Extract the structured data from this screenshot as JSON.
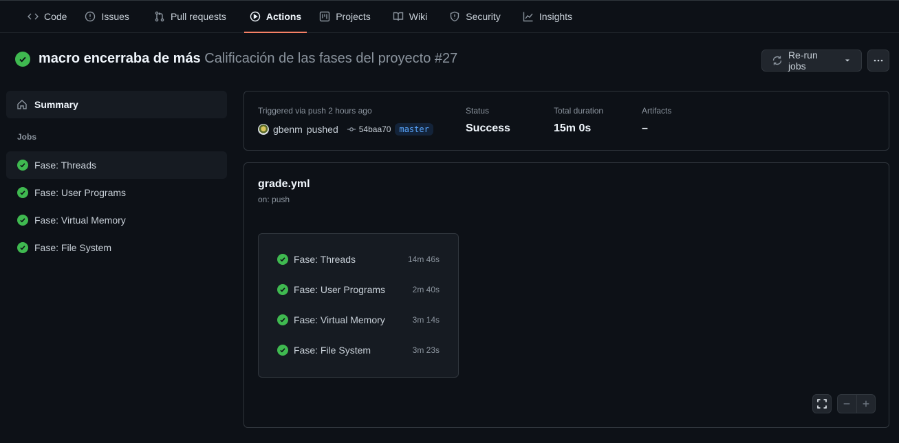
{
  "nav": [
    {
      "label": "Code",
      "icon": "code-icon"
    },
    {
      "label": "Issues",
      "icon": "issue-icon"
    },
    {
      "label": "Pull requests",
      "icon": "pull-request-icon"
    },
    {
      "label": "Actions",
      "icon": "play-icon",
      "active": true
    },
    {
      "label": "Projects",
      "icon": "project-icon"
    },
    {
      "label": "Wiki",
      "icon": "book-icon"
    },
    {
      "label": "Security",
      "icon": "shield-icon"
    },
    {
      "label": "Insights",
      "icon": "graph-icon"
    }
  ],
  "run": {
    "title": "macro encerraba de más",
    "workflow": "Calificación de las fases del proyecto #27",
    "status_icon": "check-circle-icon",
    "rerun_label": "Re-run jobs"
  },
  "sidebar": {
    "summary_label": "Summary",
    "jobs_heading": "Jobs",
    "jobs": [
      {
        "label": "Fase: Threads",
        "selected": true
      },
      {
        "label": "Fase: User Programs"
      },
      {
        "label": "Fase: Virtual Memory"
      },
      {
        "label": "Fase: File System"
      }
    ]
  },
  "info": {
    "trigger": "Triggered via push 2 hours ago",
    "user": "gbenm",
    "action": "pushed",
    "sha": "54baa70",
    "branch": "master",
    "status_label": "Status",
    "status_value": "Success",
    "duration_label": "Total duration",
    "duration_value": "15m 0s",
    "artifacts_label": "Artifacts",
    "artifacts_value": "–"
  },
  "workflow": {
    "file": "grade.yml",
    "trigger": "on: push",
    "jobs": [
      {
        "label": "Fase: Threads",
        "duration": "14m 46s"
      },
      {
        "label": "Fase: User Programs",
        "duration": "2m 40s"
      },
      {
        "label": "Fase: Virtual Memory",
        "duration": "3m 14s"
      },
      {
        "label": "Fase: File System",
        "duration": "3m 23s"
      }
    ]
  },
  "colors": {
    "success": "#3fb950",
    "accent": "#f78166",
    "link": "#58a6ff",
    "background": "#0d1117"
  }
}
